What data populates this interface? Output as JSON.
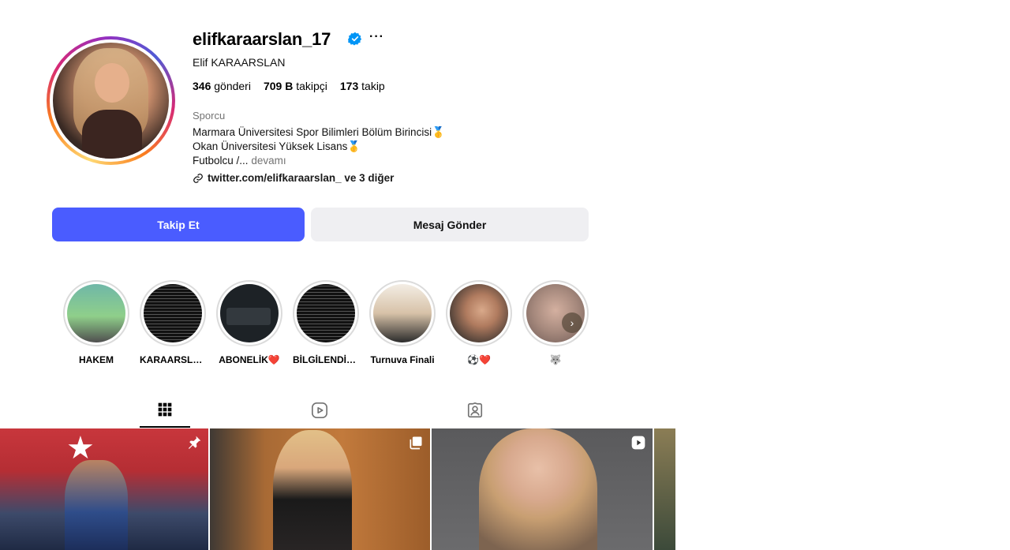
{
  "profile": {
    "username": "elifkaraarslan_17",
    "full_name": "Elif KARAARSLAN",
    "more_glyph": "···",
    "verified_color": "#0095f6",
    "stats": {
      "posts_num": "346",
      "posts_label": "gönderi",
      "followers_num": "709 B",
      "followers_label": "takipçi",
      "following_num": "173",
      "following_label": "takip"
    },
    "category": "Sporcu",
    "bio": {
      "line1": "Marmara Üniversitesi Spor Bilimleri Bölüm Birincisi🥇",
      "line2": "Okan Üniversitesi Yüksek Lisans🥇",
      "line3": "Futbolcu /...",
      "more": "devamı"
    },
    "link_text": "twitter.com/elifkaraarslan_ ve 3 diğer"
  },
  "actions": {
    "follow_label": "Takip Et",
    "message_label": "Mesaj Gönder",
    "follow_color": "#4a5cff",
    "message_color": "#efeff2"
  },
  "highlights": [
    {
      "label": "HAKEM"
    },
    {
      "label": "KARAARSLAN"
    },
    {
      "label": "ABONELİK❤️"
    },
    {
      "label": "BİLGİLENDİRME"
    },
    {
      "label": "Turnuva Finali"
    },
    {
      "label": "⚽❤️"
    },
    {
      "label": "🐺"
    }
  ],
  "highlight_next_glyph": "›",
  "tabs": [
    {
      "name": "posts",
      "icon": "grid-icon",
      "active": true
    },
    {
      "name": "reels",
      "icon": "reels-icon",
      "active": false
    },
    {
      "name": "tagged",
      "icon": "tagged-icon",
      "active": false
    }
  ],
  "posts": [
    {
      "badge": "pin-icon"
    },
    {
      "badge": "carousel-icon"
    },
    {
      "badge": "video-icon"
    },
    {
      "badge": ""
    }
  ],
  "post_star_glyph": "★"
}
